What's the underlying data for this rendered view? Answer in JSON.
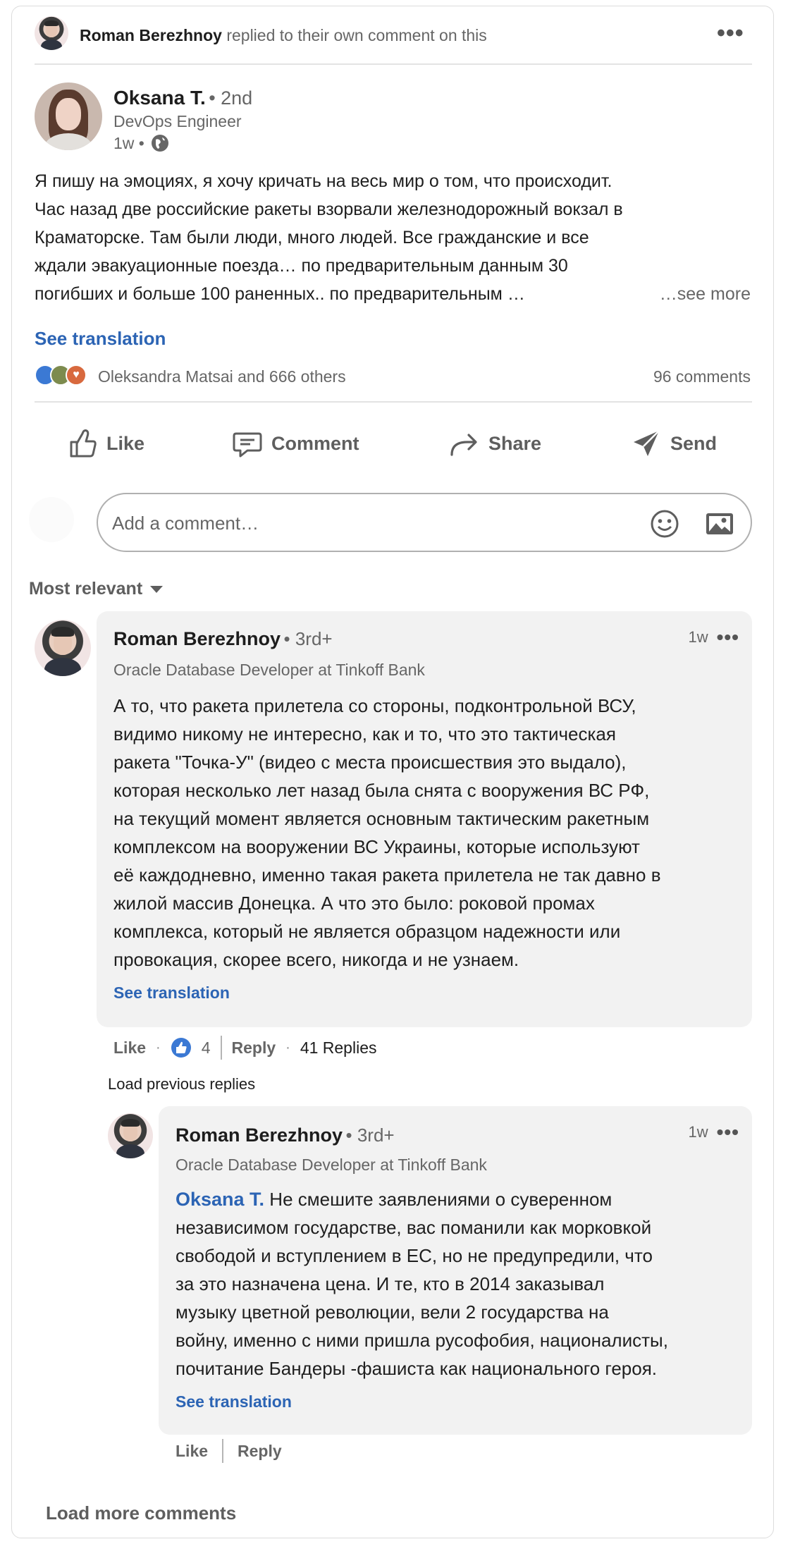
{
  "activity": {
    "actor": "Roman Berezhnoy",
    "text": "replied to their own comment on this"
  },
  "post": {
    "author": "Oksana T.",
    "degree": "• 2nd",
    "headline": "DevOps Engineer",
    "time": "1w •",
    "lines": [
      "Я пишу на эмоциях, я хочу кричать на весь мир о том, что происходит.",
      "Час назад две российские ракеты взорвали железнодорожный вокзал в",
      "Краматорске. Там были люди, много людей. Все гражданские и все",
      "ждали эвакуационные поезда… по предварительным данным 30",
      "погибших и больше 100 раненных.. по предварительным …"
    ],
    "see_more": "…see more",
    "see_translation": "See translation",
    "reactions_text": "Oleksandra Matsai and 666 others",
    "comments_count": "96 comments"
  },
  "actions": {
    "like": "Like",
    "comment": "Comment",
    "share": "Share",
    "send": "Send"
  },
  "comment_box": {
    "placeholder": "Add a comment…"
  },
  "sort": {
    "label": "Most relevant"
  },
  "comment1": {
    "author": "Roman Berezhnoy",
    "degree": "• 3rd+",
    "headline": "Oracle Database Developer at Tinkoff Bank",
    "time": "1w",
    "lines": [
      "А то, что ракета прилетела со стороны, подконтрольной ВСУ,",
      "видимо никому не интересно, как и то, что это тактическая",
      "ракета \"Точка-У\" (видео с места происшествия это выдало),",
      "которая несколько лет назад была снята с вооружения ВС РФ,",
      "на текущий момент является основным тактическим ракетным",
      "комплексом на вооружении ВС Украины, которые используют",
      "её каждодневно, именно такая ракета прилетела не так давно в",
      "жилой массив Донецка. А что это было: роковой промах",
      "комплекса, который не является образцом надежности или",
      "провокация, скорее всего, никогда и не узнаем."
    ],
    "see_translation": "See translation",
    "like": "Like",
    "like_count": "4",
    "reply": "Reply",
    "replies": "41 Replies"
  },
  "load_previous": "Load previous replies",
  "reply1": {
    "author": "Roman Berezhnoy",
    "degree": "• 3rd+",
    "headline": "Oracle Database Developer at Tinkoff Bank",
    "time": "1w",
    "mention": "Oksana T.",
    "first_line_rest": " Не смешите заявлениями о суверенном",
    "lines": [
      "независимом государстве, вас поманили как морковкой",
      "свободой и вступлением в ЕС, но не предупредили, что",
      "за это назначена цена. И те, кто в 2014 заказывал",
      "музыку цветной революции, вели 2 государства на",
      "войну, именно с ними пришла русофобия, националисты,",
      "почитание Бандеры -фашиста как национального героя."
    ],
    "see_translation": "See translation",
    "like": "Like",
    "reply": "Reply"
  },
  "load_more": "Load more comments",
  "colors": {
    "link": "#2c64b4",
    "bubble": "#f2f2f2",
    "muted": "#666666"
  }
}
